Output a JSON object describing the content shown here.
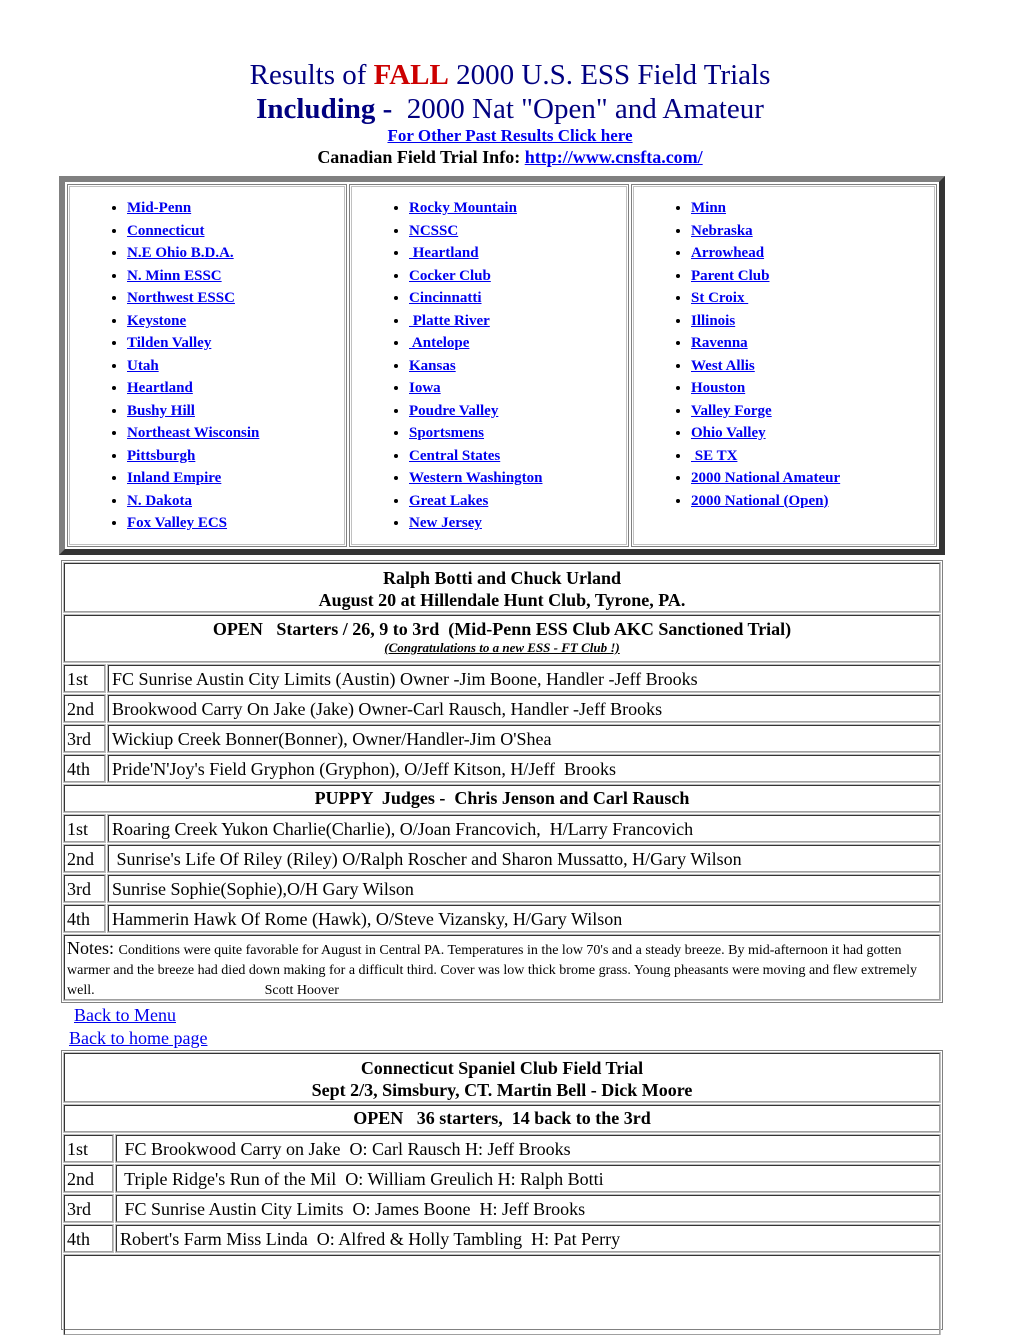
{
  "header": {
    "title_prefix": "Results of ",
    "title_highlight": "FALL",
    "title_suffix": " 2000 U.S. ESS Field Trials",
    "subtitle_bold": "Including - ",
    "subtitle_rest": " 2000 Nat \"Open\" and Amateur",
    "past_results_link": "For Other Past Results Click here",
    "canadian_label": "Canadian Field Trial Info: ",
    "canadian_link": "http://www.cnsfta.com/",
    "highlight_color": "#cc0000",
    "title_color": "#000080"
  },
  "menu": {
    "columns": [
      [
        "Mid-Penn",
        "Connecticut",
        "N.E Ohio B.D.A.",
        "N. Minn ESSC",
        "Northwest ESSC",
        "Keystone",
        "Tilden Valley",
        "Utah",
        "Heartland",
        "Bushy Hill",
        "Northeast Wisconsin",
        "Pittsburgh",
        "Inland Empire",
        "N. Dakota",
        "Fox Valley ECS"
      ],
      [
        "Rocky Mountain",
        "NCSSC",
        " Heartland",
        "Cocker Club",
        "Cincinnatti",
        " Platte River",
        " Antelope",
        "Kansas",
        "Iowa",
        "Poudre Valley",
        "Sportsmens",
        "Central States",
        "Western Washington",
        "Great Lakes",
        "New Jersey"
      ],
      [
        "Minn",
        "Nebraska",
        "Arrowhead",
        "Parent Club",
        "St Croix ",
        "Illinois",
        "Ravenna",
        "West Allis",
        "Houston",
        "Valley Forge",
        "Ohio Valley",
        " SE TX",
        "2000 National Amateur",
        "2000 National (Open)"
      ]
    ]
  },
  "sections": [
    {
      "judges_line": "Ralph Botti and Chuck Urland",
      "date_line": "August 20 at Hillendale Hunt Club,  Tyrone, PA.",
      "open_header": "OPEN   Starters / 26, 9 to 3rd  (Mid-Penn ESS Club AKC Sanctioned Trial)",
      "congrats": "(Congratulations to a new ESS -  FT Club !)",
      "open_results": [
        {
          "place": "1st",
          "entry": "FC Sunrise Austin City Limits (Austin) Owner -Jim Boone, Handler -Jeff Brooks"
        },
        {
          "place": "2nd",
          "entry": "Brookwood Carry On Jake (Jake) Owner-Carl Rausch, Handler -Jeff Brooks"
        },
        {
          "place": "3rd",
          "entry": "Wickiup Creek Bonner(Bonner), Owner/Handler-Jim O'Shea"
        },
        {
          "place": "4th",
          "entry": "Pride'N'Joy's Field Gryphon (Gryphon), O/Jeff Kitson, H/Jeff  Brooks"
        }
      ],
      "puppy_header": "PUPPY  Judges -  Chris Jenson and Carl Rausch",
      "puppy_results": [
        {
          "place": "1st",
          "entry": "Roaring Creek Yukon Charlie(Charlie), O/Joan Francovich,  H/Larry Francovich"
        },
        {
          "place": "2nd",
          "entry": " Sunrise's Life Of Riley (Riley) O/Ralph Roscher and Sharon Mussatto, H/Gary Wilson"
        },
        {
          "place": "3rd",
          "entry": "Sunrise Sophie(Sophie),O/H Gary Wilson"
        },
        {
          "place": "4th",
          "entry": "Hammerin Hawk Of Rome (Hawk), O/Steve Vizansky, H/Gary Wilson"
        }
      ],
      "notes_label": "Notes: ",
      "notes_text": "Conditions were quite favorable for August in Central PA. Temperatures in the low 70's and a steady breeze. By mid-afternoon it had gotten warmer and the breeze had died down making for a difficult third. Cover was low thick brome grass. Young pheasants were moving and flew extremely well.",
      "notes_author": "Scott Hoover"
    },
    {
      "title_line": "Connecticut Spaniel Club Field Trial",
      "date_line": "Sept 2/3, Simsbury, CT.  Martin Bell - Dick Moore",
      "open_header": "OPEN   36 starters,  14 back to the 3rd",
      "open_results": [
        {
          "place": "1st",
          "entry": " FC Brookwood Carry on Jake  O: Carl Rausch H: Jeff Brooks"
        },
        {
          "place": "2nd",
          "entry": " Triple Ridge's Run of the Mil  O: William Greulich H: Ralph Botti"
        },
        {
          "place": "3rd",
          "entry": " FC Sunrise Austin City Limits  O: James Boone  H: Jeff Brooks"
        },
        {
          "place": "4th",
          "entry": "Robert's Farm Miss Linda  O: Alfred & Holly Tambling  H: Pat Perry"
        }
      ]
    }
  ],
  "back_links": {
    "menu": "Back to Menu",
    "home": "Back to home page"
  }
}
